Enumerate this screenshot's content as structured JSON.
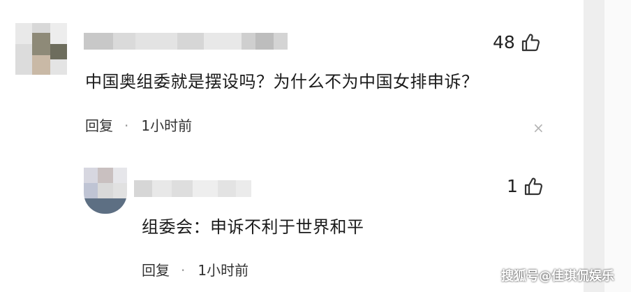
{
  "comments": [
    {
      "likes": "48",
      "text": "中国奥组委就是摆设吗？为什么不为中国女排申诉？",
      "reply_label": "回复",
      "separator": "·",
      "time": "1小时前",
      "close_glyph": "×"
    },
    {
      "likes": "1",
      "text": "组委会：申诉不利于世界和平",
      "reply_label": "回复",
      "separator": "·",
      "time": "1小时前"
    }
  ],
  "watermark": "搜狐号@佳琪侃娱乐",
  "colors": {
    "text": "#1a1a1a",
    "meta": "#333333",
    "scrollbar_track": "#eeeeee"
  },
  "icons": {
    "like": "thumbs-up-icon",
    "dismiss": "close-icon"
  }
}
